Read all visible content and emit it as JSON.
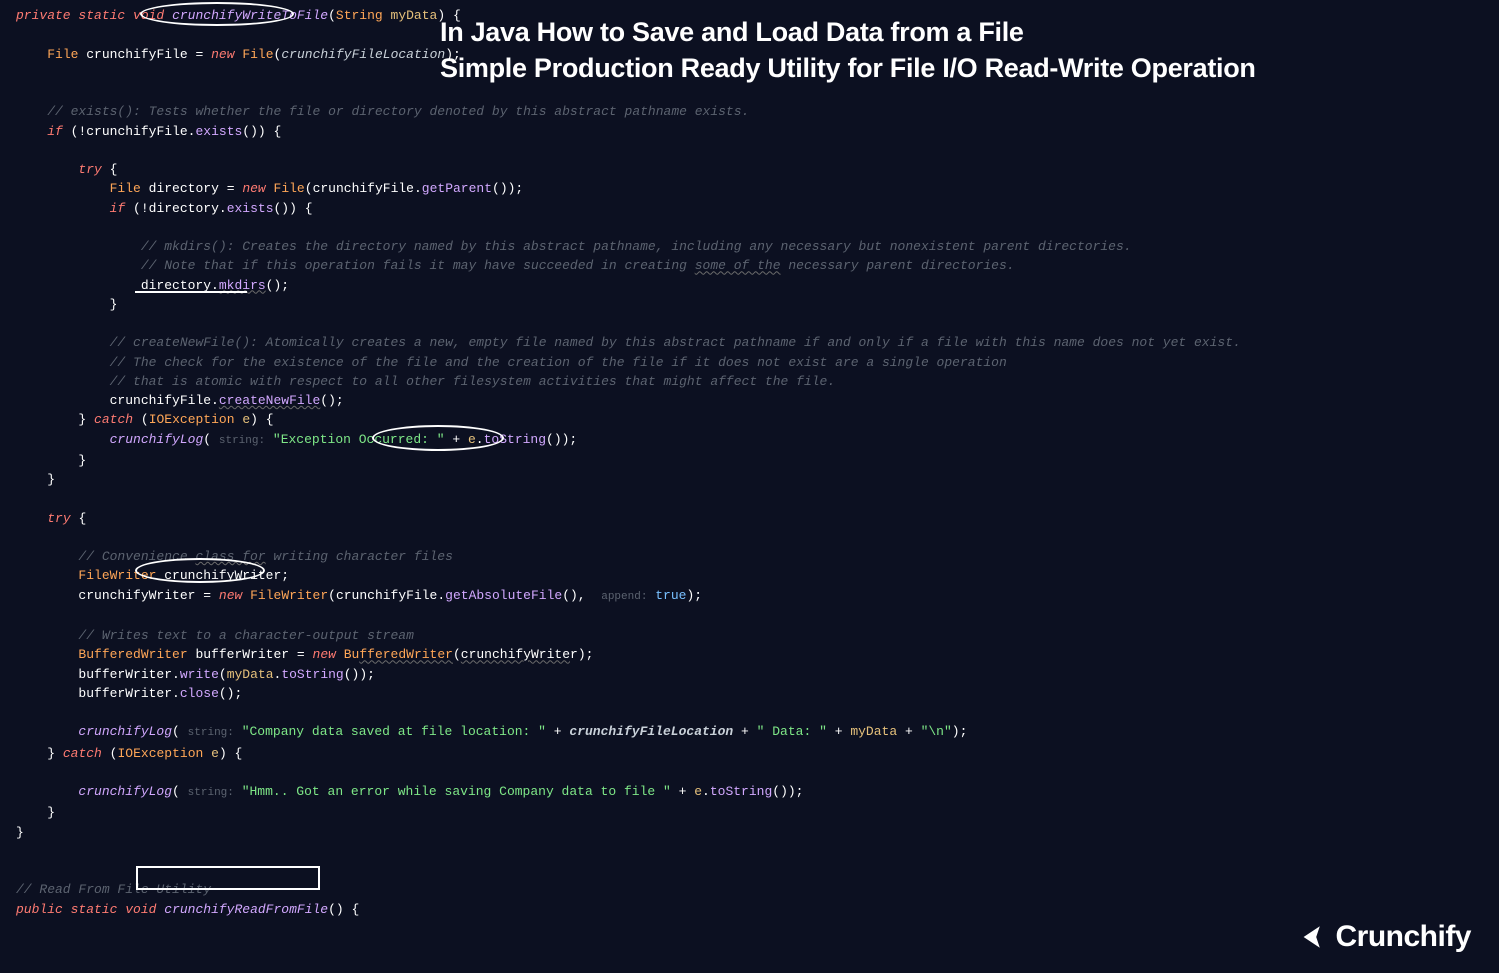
{
  "overlay": {
    "line1": "In Java How to Save and Load Data from a File",
    "line2": "Simple Production Ready Utility for File I/O Read-Write Operation"
  },
  "code": {
    "sig_kw1": "private static",
    "sig_void": "void",
    "sig_name": "crunchifyWriteToFile",
    "sig_ptype": "String",
    "sig_pname": "myData",
    "l2_type": "File",
    "l2_var": "crunchifyFile",
    "l2_new": "new",
    "l2_ctor": "File",
    "l2_arg": "crunchifyFileLocation",
    "c_exists": "// exists(): Tests whether the file or directory denoted by this abstract pathname exists.",
    "if1_kw": "if",
    "if1_target": "crunchifyFile",
    "if1_call": "exists",
    "try_kw": "try",
    "dir_type": "File",
    "dir_var": "directory",
    "dir_new": "new",
    "dir_ctor": "File",
    "dir_obj": "crunchifyFile",
    "dir_call": "getParent",
    "if2_kw": "if",
    "if2_obj": "directory",
    "if2_call": "exists",
    "c_mkdirs1": "// mkdirs(): Creates the directory named by this abstract pathname, including any necessary but nonexistent parent directories.",
    "c_mkdirs2a": "// Note that if this operation fails it may have succeeded in creating ",
    "c_mkdirs2b": "some of the",
    "c_mkdirs2c": " necessary parent directories.",
    "mk_obj": "directory",
    "mk_call": "mkdirs",
    "c_cnf1": "// createNewFile(): Atomically creates a new, empty file named by this abstract pathname if and only if a file with this name does not yet exist.",
    "c_cnf2": "// The check for the existence of the file and the creation of the file if it does not exist are a single operation",
    "c_cnf3": "// that is atomic with respect to all other filesystem activities that might affect the file.",
    "cnf_obj": "crunchifyFile",
    "cnf_call": "createNewFile",
    "catch_kw": "catch",
    "catch_type": "IOException",
    "catch_var": "e",
    "log_fn": "crunchifyLog",
    "log_hint": "string:",
    "log_str": "\"Exception Occurred: \"",
    "log_plus": "+",
    "log_e": "e",
    "log_tostr": "toString",
    "try2_kw": "try",
    "c_fw": "// Convenience class for writing character files",
    "c_fw_wave": "class for",
    "fw_type": "FileWriter",
    "fw_var": "crunchifyWriter",
    "fw_asgn_obj": "crunchifyWriter",
    "fw_new": "new",
    "fw_ctor": "FileWriter",
    "fw_a1_obj": "crunchifyFile",
    "fw_a1": "getAbsoluteFile",
    "fw_hint": "append:",
    "fw_true": "true",
    "c_bw": "// Writes text to a character-output stream",
    "bw_type": "BufferedWriter",
    "bw_var": "bufferWriter",
    "bw_new": "new",
    "bw_ctor_pre": "Bu",
    "bw_ctor_wave": "fferedWriter",
    "bw_arg": "crunchifyWrite",
    "bw_arg_tail": "r",
    "bw_w_obj": "bufferWriter",
    "bw_w": "write",
    "bw_w_arg_obj": "myData",
    "bw_w_arg_call": "toString",
    "bw_c_obj": "bufferWriter",
    "bw_c": "close",
    "log2_fn": "crunchifyLog",
    "log2_hint": "string:",
    "log2_s1": "\"Company data saved at file location: \"",
    "log2_v1": "crunchifyFileLocation",
    "log2_s2": "\" Data: \"",
    "log2_v2": "myData",
    "log2_s3": "\"\\n\"",
    "catch2_kw": "catch",
    "catch2_type": "IOException",
    "catch2_var": "e",
    "log3_fn": "crunchifyLog",
    "log3_hint": "string:",
    "log3_s": "\"Hmm.. Got an error while saving Company data to file \"",
    "log3_e": "e",
    "log3_ts": "toString",
    "c_read": "// Read From File Utility",
    "read_kw": "public static",
    "read_void": "void",
    "read_name": "crunchifyReadFromFile"
  },
  "brand": "Crunchify"
}
